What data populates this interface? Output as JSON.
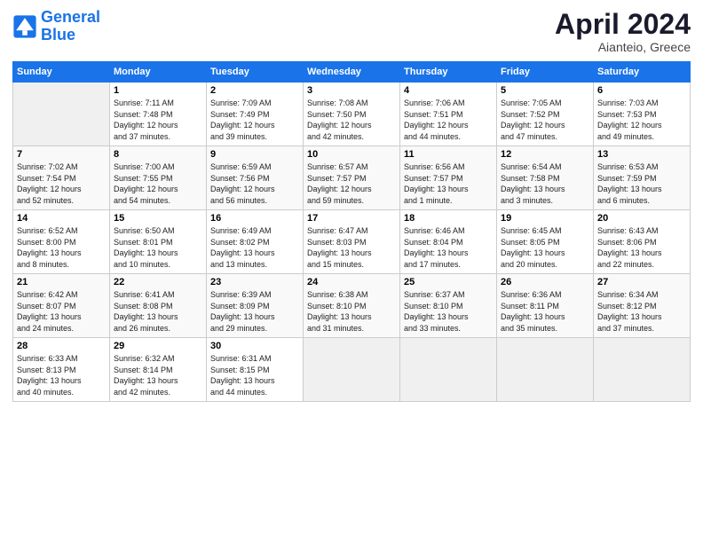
{
  "logo": {
    "line1": "General",
    "line2": "Blue"
  },
  "title": "April 2024",
  "location": "Aianteio, Greece",
  "header_days": [
    "Sunday",
    "Monday",
    "Tuesday",
    "Wednesday",
    "Thursday",
    "Friday",
    "Saturday"
  ],
  "weeks": [
    [
      {
        "num": "",
        "info": ""
      },
      {
        "num": "1",
        "info": "Sunrise: 7:11 AM\nSunset: 7:48 PM\nDaylight: 12 hours\nand 37 minutes."
      },
      {
        "num": "2",
        "info": "Sunrise: 7:09 AM\nSunset: 7:49 PM\nDaylight: 12 hours\nand 39 minutes."
      },
      {
        "num": "3",
        "info": "Sunrise: 7:08 AM\nSunset: 7:50 PM\nDaylight: 12 hours\nand 42 minutes."
      },
      {
        "num": "4",
        "info": "Sunrise: 7:06 AM\nSunset: 7:51 PM\nDaylight: 12 hours\nand 44 minutes."
      },
      {
        "num": "5",
        "info": "Sunrise: 7:05 AM\nSunset: 7:52 PM\nDaylight: 12 hours\nand 47 minutes."
      },
      {
        "num": "6",
        "info": "Sunrise: 7:03 AM\nSunset: 7:53 PM\nDaylight: 12 hours\nand 49 minutes."
      }
    ],
    [
      {
        "num": "7",
        "info": "Sunrise: 7:02 AM\nSunset: 7:54 PM\nDaylight: 12 hours\nand 52 minutes."
      },
      {
        "num": "8",
        "info": "Sunrise: 7:00 AM\nSunset: 7:55 PM\nDaylight: 12 hours\nand 54 minutes."
      },
      {
        "num": "9",
        "info": "Sunrise: 6:59 AM\nSunset: 7:56 PM\nDaylight: 12 hours\nand 56 minutes."
      },
      {
        "num": "10",
        "info": "Sunrise: 6:57 AM\nSunset: 7:57 PM\nDaylight: 12 hours\nand 59 minutes."
      },
      {
        "num": "11",
        "info": "Sunrise: 6:56 AM\nSunset: 7:57 PM\nDaylight: 13 hours\nand 1 minute."
      },
      {
        "num": "12",
        "info": "Sunrise: 6:54 AM\nSunset: 7:58 PM\nDaylight: 13 hours\nand 3 minutes."
      },
      {
        "num": "13",
        "info": "Sunrise: 6:53 AM\nSunset: 7:59 PM\nDaylight: 13 hours\nand 6 minutes."
      }
    ],
    [
      {
        "num": "14",
        "info": "Sunrise: 6:52 AM\nSunset: 8:00 PM\nDaylight: 13 hours\nand 8 minutes."
      },
      {
        "num": "15",
        "info": "Sunrise: 6:50 AM\nSunset: 8:01 PM\nDaylight: 13 hours\nand 10 minutes."
      },
      {
        "num": "16",
        "info": "Sunrise: 6:49 AM\nSunset: 8:02 PM\nDaylight: 13 hours\nand 13 minutes."
      },
      {
        "num": "17",
        "info": "Sunrise: 6:47 AM\nSunset: 8:03 PM\nDaylight: 13 hours\nand 15 minutes."
      },
      {
        "num": "18",
        "info": "Sunrise: 6:46 AM\nSunset: 8:04 PM\nDaylight: 13 hours\nand 17 minutes."
      },
      {
        "num": "19",
        "info": "Sunrise: 6:45 AM\nSunset: 8:05 PM\nDaylight: 13 hours\nand 20 minutes."
      },
      {
        "num": "20",
        "info": "Sunrise: 6:43 AM\nSunset: 8:06 PM\nDaylight: 13 hours\nand 22 minutes."
      }
    ],
    [
      {
        "num": "21",
        "info": "Sunrise: 6:42 AM\nSunset: 8:07 PM\nDaylight: 13 hours\nand 24 minutes."
      },
      {
        "num": "22",
        "info": "Sunrise: 6:41 AM\nSunset: 8:08 PM\nDaylight: 13 hours\nand 26 minutes."
      },
      {
        "num": "23",
        "info": "Sunrise: 6:39 AM\nSunset: 8:09 PM\nDaylight: 13 hours\nand 29 minutes."
      },
      {
        "num": "24",
        "info": "Sunrise: 6:38 AM\nSunset: 8:10 PM\nDaylight: 13 hours\nand 31 minutes."
      },
      {
        "num": "25",
        "info": "Sunrise: 6:37 AM\nSunset: 8:10 PM\nDaylight: 13 hours\nand 33 minutes."
      },
      {
        "num": "26",
        "info": "Sunrise: 6:36 AM\nSunset: 8:11 PM\nDaylight: 13 hours\nand 35 minutes."
      },
      {
        "num": "27",
        "info": "Sunrise: 6:34 AM\nSunset: 8:12 PM\nDaylight: 13 hours\nand 37 minutes."
      }
    ],
    [
      {
        "num": "28",
        "info": "Sunrise: 6:33 AM\nSunset: 8:13 PM\nDaylight: 13 hours\nand 40 minutes."
      },
      {
        "num": "29",
        "info": "Sunrise: 6:32 AM\nSunset: 8:14 PM\nDaylight: 13 hours\nand 42 minutes."
      },
      {
        "num": "30",
        "info": "Sunrise: 6:31 AM\nSunset: 8:15 PM\nDaylight: 13 hours\nand 44 minutes."
      },
      {
        "num": "",
        "info": ""
      },
      {
        "num": "",
        "info": ""
      },
      {
        "num": "",
        "info": ""
      },
      {
        "num": "",
        "info": ""
      }
    ]
  ]
}
